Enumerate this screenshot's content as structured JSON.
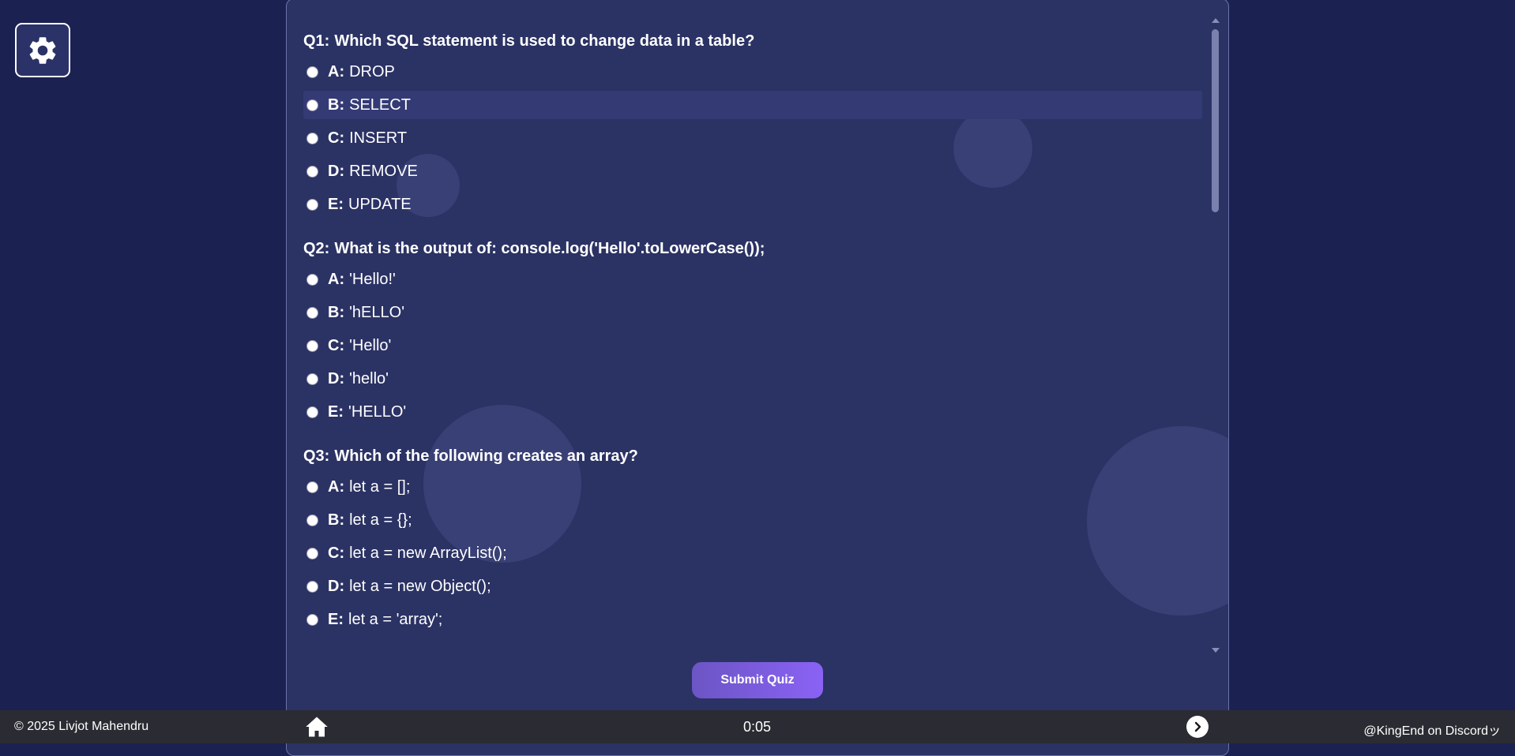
{
  "settings": {
    "icon": "gear-icon"
  },
  "questions": [
    {
      "number": "Q1:",
      "text": "Which SQL statement is used to change data in a table?",
      "options": [
        {
          "letter": "A:",
          "text": "DROP"
        },
        {
          "letter": "B:",
          "text": "SELECT"
        },
        {
          "letter": "C:",
          "text": "INSERT"
        },
        {
          "letter": "D:",
          "text": "REMOVE"
        },
        {
          "letter": "E:",
          "text": "UPDATE"
        }
      ]
    },
    {
      "number": "Q2:",
      "text": "What is the output of: console.log('Hello'.toLowerCase());",
      "options": [
        {
          "letter": "A:",
          "text": "'Hello!'"
        },
        {
          "letter": "B:",
          "text": "'hELLO'"
        },
        {
          "letter": "C:",
          "text": "'Hello'"
        },
        {
          "letter": "D:",
          "text": "'hello'"
        },
        {
          "letter": "E:",
          "text": "'HELLO'"
        }
      ]
    },
    {
      "number": "Q3:",
      "text": "Which of the following creates an array?",
      "options": [
        {
          "letter": "A:",
          "text": "let a = [];"
        },
        {
          "letter": "B:",
          "text": "let a = {};"
        },
        {
          "letter": "C:",
          "text": "let a = new ArrayList();"
        },
        {
          "letter": "D:",
          "text": "let a = new Object();"
        },
        {
          "letter": "E:",
          "text": "let a = 'array';"
        }
      ]
    }
  ],
  "submit_label": "Submit Quiz",
  "footer": {
    "copyright": "© 2025 Livjot Mahendru",
    "timer": "0:05",
    "discord": "@KingEnd on Discordッ",
    "home_icon": "home-icon",
    "next_icon": "chevron-right-icon"
  }
}
